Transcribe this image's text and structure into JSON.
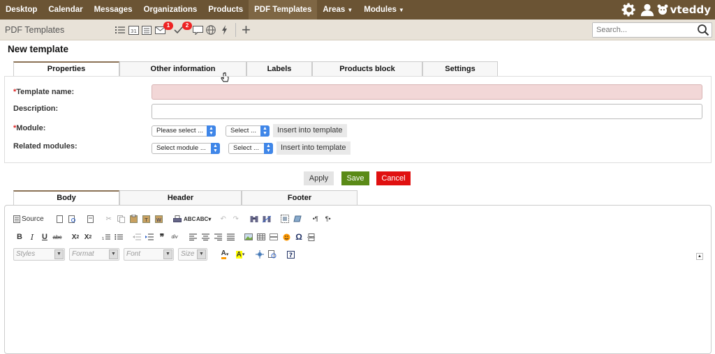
{
  "nav": {
    "items": [
      "Desktop",
      "Calendar",
      "Messages",
      "Organizations",
      "Products",
      "PDF Templates",
      "Areas",
      "Modules"
    ],
    "active": "PDF Templates",
    "brand": "vteddy",
    "bg_color": "#6b5434"
  },
  "subbar": {
    "title": "PDF Templates",
    "badges": {
      "mail": "1",
      "tasks": "2"
    },
    "search_placeholder": "Search..."
  },
  "page": {
    "title": "New template"
  },
  "tabs": [
    "Properties",
    "Other information",
    "Labels",
    "Products block",
    "Settings"
  ],
  "form": {
    "template_name_label": "Template name:",
    "description_label": "Description:",
    "module_label": "Module:",
    "related_label": "Related modules:",
    "module_select": "Please select ...",
    "module_field_select": "Select ...",
    "related_select": "Select module ...",
    "related_field_select": "Select ...",
    "insert_label": "Insert into template",
    "required_mark": "*"
  },
  "actions": {
    "apply": "Apply",
    "save": "Save",
    "cancel": "Cancel"
  },
  "editor_tabs": [
    "Body",
    "Header",
    "Footer"
  ],
  "editor": {
    "source_label": "Source",
    "combos": [
      "Styles",
      "Format",
      "Font",
      "Size"
    ]
  }
}
